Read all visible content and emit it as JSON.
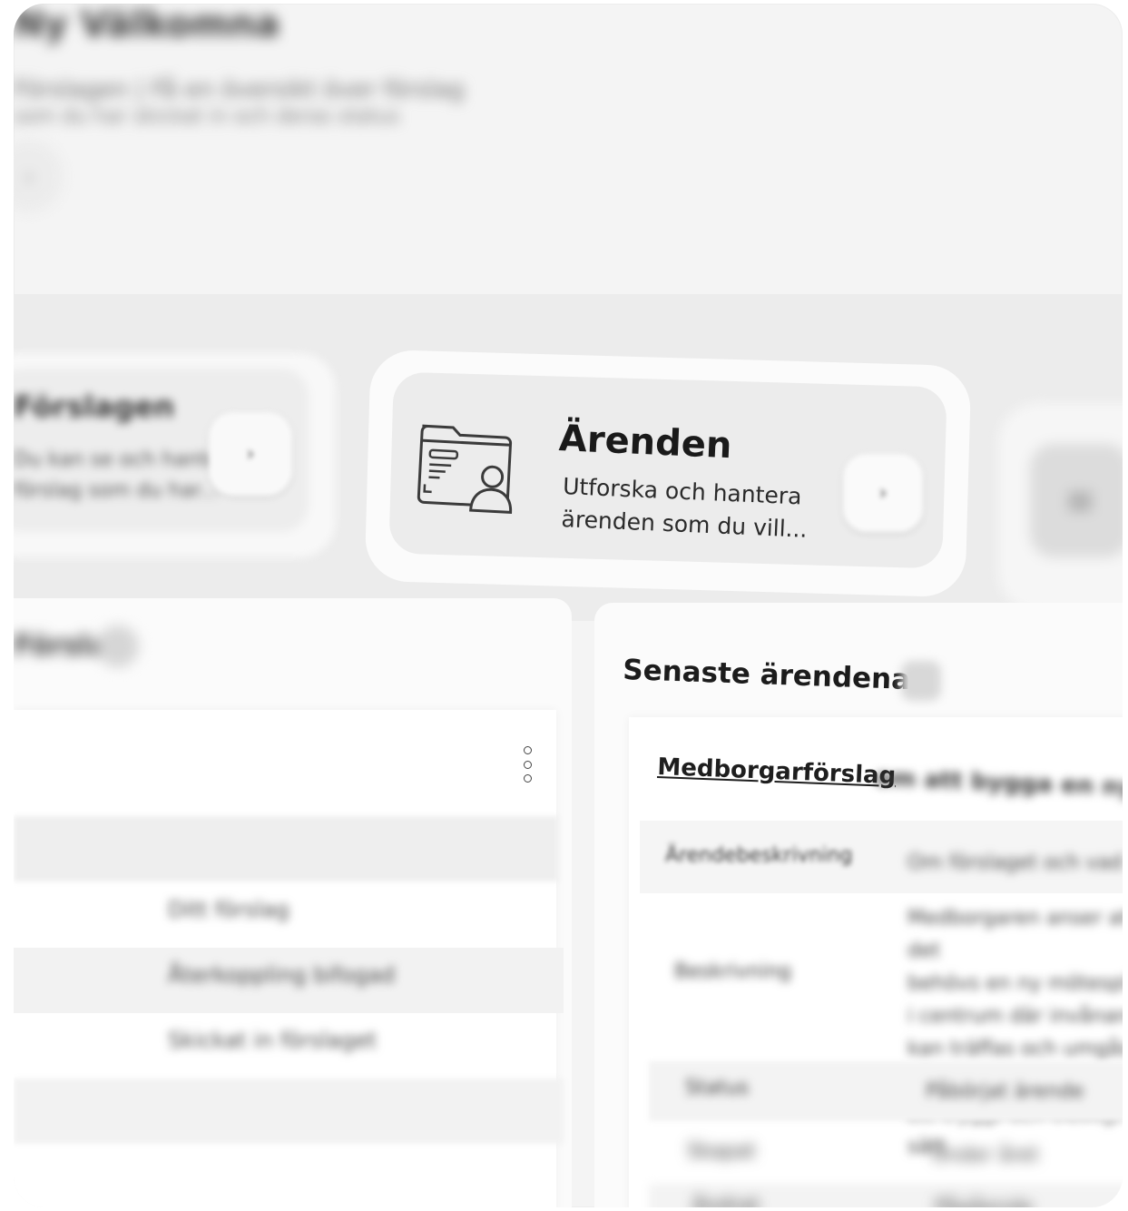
{
  "header": {
    "title": "Ny Välkomna",
    "subtitle_line1": "Förslagen | Få en översikt över förslag",
    "subtitle_line2": "som du har skickat in och deras status",
    "button_glyph": "›"
  },
  "cards": [
    {
      "title": "Förslagen",
      "description_line1": "Du kan se och hantera",
      "description_line2": "förslag som du har...",
      "button_glyph": "›",
      "icon": "chevron-right-icon"
    },
    {
      "title": "Ärenden",
      "description_line1": "Utforska och hantera",
      "description_line2": "ärenden som du vill...",
      "button_glyph": "›",
      "icon": "folder-person-icon"
    },
    {
      "title": "",
      "icon": "clipboard-icon",
      "icon_glyph": "≡"
    }
  ],
  "left_panel": {
    "title": "Förslag",
    "rows": [
      {
        "value": "Ditt förslag"
      },
      {
        "value": "Återkoppling bifogad"
      },
      {
        "value": "Skickat in förslaget"
      }
    ]
  },
  "right_panel": {
    "title": "Senaste ärendena",
    "case_link": "Medborgarförslag",
    "case_link_rest": "om att bygga en ny plats",
    "fields": [
      {
        "label": "Ärendebeskrivning",
        "value": "Om förslaget och vad det gäller"
      },
      {
        "label": "Beskrivning",
        "value": ""
      },
      {
        "label": "Status",
        "value": "Påbörjat ärende"
      },
      {
        "label": "Skapat",
        "value": "Under året"
      },
      {
        "label": "Ändrat",
        "value": "Pågående"
      }
    ],
    "description_lines": [
      "Medborgaren anser att det",
      "behövs en ny mötesplats",
      "i centrum där invånare",
      "kan träffas och umgås på",
      "ett tryggt och trevligt sätt"
    ]
  },
  "colors": {
    "background": "#f4f4f4",
    "card": "#ececec",
    "text": "#1a1a1a"
  }
}
